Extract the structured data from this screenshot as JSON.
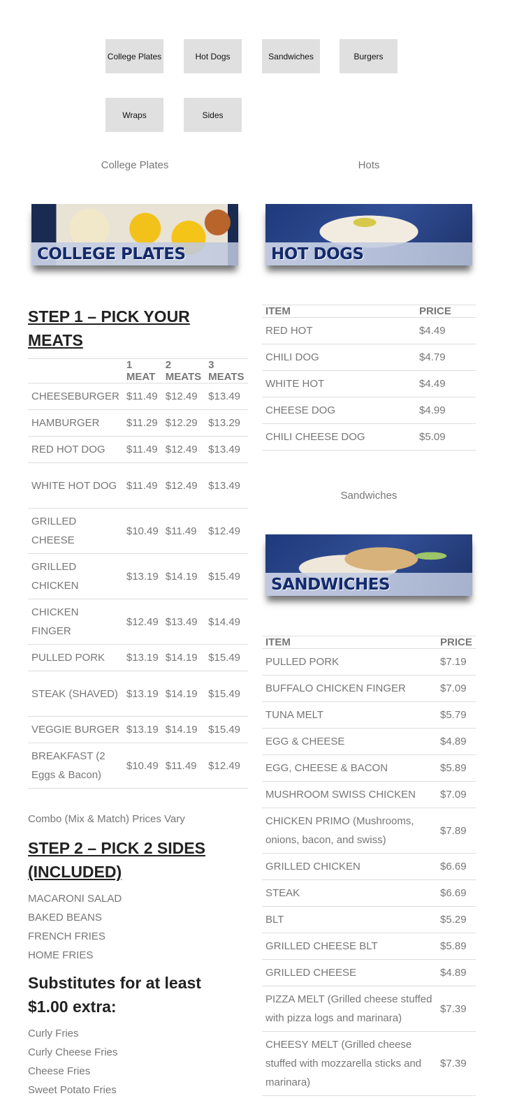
{
  "nav": {
    "buttons": [
      "College Plates",
      "Hot Dogs",
      "Sandwiches",
      "Burgers",
      "Wraps",
      "Sides"
    ]
  },
  "captions": {
    "college_plates": "College Plates",
    "hots": "Hots",
    "sandwiches": "Sandwiches"
  },
  "banners": {
    "college_plates": "COLLEGE PLATES",
    "hot_dogs": "HOT DOGS",
    "sandwiches": "SANDWICHES"
  },
  "plates": {
    "step1": "STEP 1 – PICK YOUR MEATS",
    "headers": [
      "",
      "1 MEAT",
      "2 MEATS",
      "3 MEATS"
    ],
    "rows": [
      [
        "CHEESEBURGER",
        "$11.49",
        "$12.49",
        "$13.49"
      ],
      [
        "HAMBURGER",
        "$11.29",
        "$12.29",
        "$13.29"
      ],
      [
        "RED HOT DOG",
        "$11.49",
        "$12.49",
        "$13.49"
      ],
      [
        "WHITE HOT DOG",
        "$11.49",
        "$12.49",
        "$13.49"
      ],
      [
        "GRILLED CHEESE",
        "$10.49",
        "$11.49",
        "$12.49"
      ],
      [
        "GRILLED CHICKEN",
        "$13.19",
        "$14.19",
        "$15.49"
      ],
      [
        "CHICKEN FINGER",
        "$12.49",
        "$13.49",
        "$14.49"
      ],
      [
        "PULLED PORK",
        "$13.19",
        "$14.19",
        "$15.49"
      ],
      [
        "STEAK (SHAVED)",
        "$13.19",
        "$14.19",
        "$15.49"
      ],
      [
        "VEGGIE BURGER",
        "$13.19",
        "$14.19",
        "$15.49"
      ],
      [
        "BREAKFAST (2 Eggs & Bacon)",
        "$10.49",
        "$11.49",
        "$12.49"
      ]
    ],
    "combo_note": "Combo (Mix & Match) Prices Vary",
    "step2": "STEP 2 – PICK 2 SIDES (INCLUDED)",
    "sides": [
      "MACARONI SALAD",
      "BAKED BEANS",
      "FRENCH FRIES",
      "HOME FRIES"
    ],
    "substitutes_heading": "Substitutes for at least $1.00 extra:",
    "substitutes": [
      "Curly Fries",
      "Curly Cheese Fries",
      "Cheese Fries",
      "Sweet Potato Fries"
    ]
  },
  "hots": {
    "headers": [
      "ITEM",
      "PRICE"
    ],
    "rows": [
      [
        "RED HOT",
        "$4.49"
      ],
      [
        "CHILI DOG",
        "$4.79"
      ],
      [
        "WHITE HOT",
        "$4.49"
      ],
      [
        "CHEESE DOG",
        "$4.99"
      ],
      [
        "CHILI CHEESE DOG",
        "$5.09"
      ]
    ]
  },
  "sandwiches": {
    "headers": [
      "ITEM",
      "PRICE"
    ],
    "rows": [
      [
        "PULLED PORK",
        "$7.19"
      ],
      [
        "BUFFALO CHICKEN FINGER",
        "$7.09"
      ],
      [
        "TUNA MELT",
        "$5.79"
      ],
      [
        "EGG & CHEESE",
        "$4.89"
      ],
      [
        "EGG, CHEESE & BACON",
        "$5.89"
      ],
      [
        "MUSHROOM SWISS CHICKEN",
        "$7.09"
      ],
      [
        "CHICKEN PRIMO (Mushrooms, onions, bacon, and swiss)",
        "$7.89"
      ],
      [
        "GRILLED CHICKEN",
        "$6.69"
      ],
      [
        "STEAK",
        "$6.69"
      ],
      [
        "BLT",
        "$5.29"
      ],
      [
        "GRILLED CHEESE BLT",
        "$5.89"
      ],
      [
        "GRILLED CHEESE",
        "$4.89"
      ],
      [
        "PIZZA MELT (Grilled cheese stuffed with pizza logs and marinara)",
        "$7.39"
      ],
      [
        "CHEESY MELT (Grilled cheese stuffed with mozzarella sticks and marinara)",
        "$7.39"
      ]
    ]
  }
}
